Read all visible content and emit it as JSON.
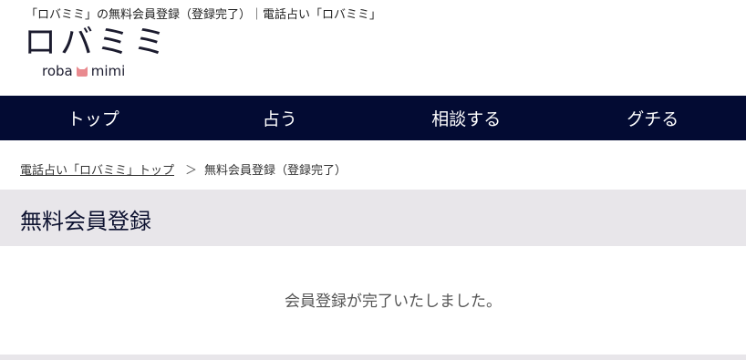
{
  "header": {
    "tagline": "「ロバミミ」の無料会員登録（登録完了）｜電話占い「ロバミミ」",
    "logo_main": "ロバミミ",
    "logo_sub_left": "roba",
    "logo_sub_right": "mimi",
    "logo_icon": "cat-face-icon",
    "logo_icon_color": "#e98a8f"
  },
  "nav": {
    "background": "#030b33",
    "items": [
      {
        "label": "トップ"
      },
      {
        "label": "占う"
      },
      {
        "label": "相談する"
      },
      {
        "label": "グチる"
      }
    ]
  },
  "breadcrumb": {
    "home_label": "電話占い「ロバミミ」トップ",
    "separator": "＞",
    "current": "無料会員登録（登録完了）"
  },
  "main": {
    "title": "無料会員登録",
    "message": "会員登録が完了いたしました。"
  }
}
